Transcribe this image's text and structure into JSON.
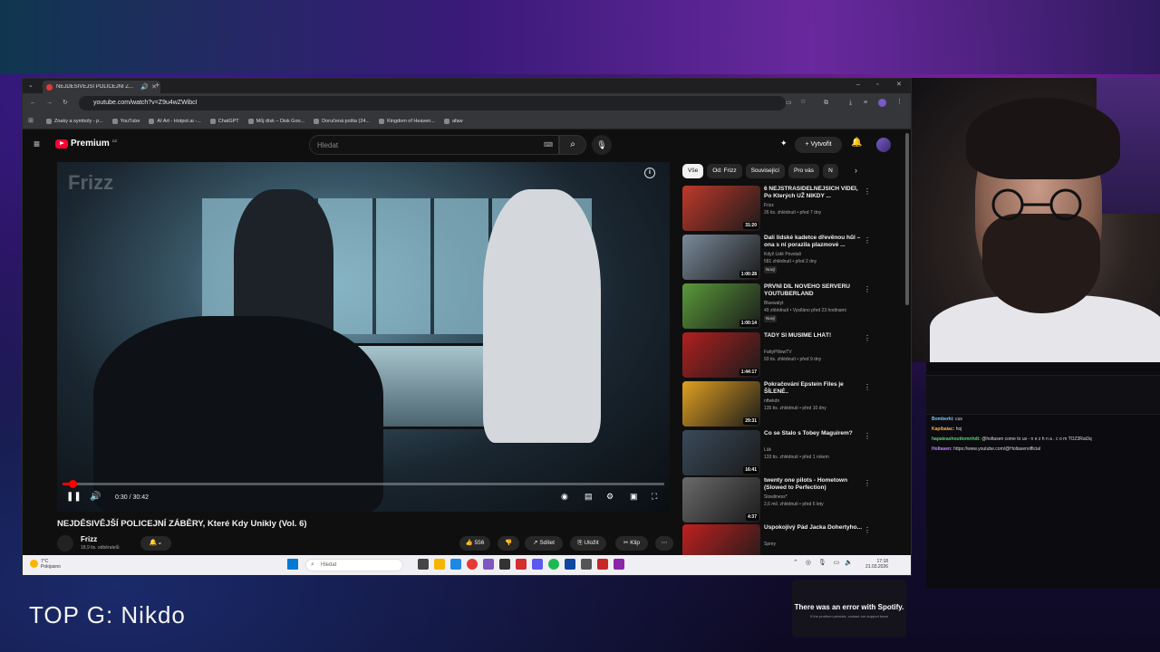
{
  "overlay": {
    "top_g_label": "TOP G: Nikdo",
    "spotify_error_title": "There was an error with Spotify.",
    "spotify_error_sub": "If the problem persists, contact our support team",
    "chat": [
      {
        "name": "Bomberki:",
        "text": "cus",
        "color": "#7ec8ff"
      },
      {
        "name": "Kapibaiac:",
        "text": "hoj",
        "color": "#ffb04a"
      },
      {
        "name": "hapaieashouttomnhdt:",
        "text": "@holtasen come to us - n e z h n a . c o m TOZ3Rat3q",
        "color": "#5ad07a"
      },
      {
        "name": "Holtasen:",
        "text": "https://www.youtube.com/@Holtasenofficial",
        "color": "#c08aff"
      }
    ]
  },
  "browser": {
    "tab_title": "NEJDĚSIVĚJŠÍ POLICEJNÍ Z...",
    "url": "youtube.com/watch?v=Z9u4wZWibcI",
    "bookmarks": [
      "Znaky a symboly - p...",
      "YouTube",
      "AI Art - Hotpot.ai -...",
      "ChatGPT",
      "Můj disk – Disk Goo...",
      "Doručená pošta (24...",
      "Kingdom of Heaven...",
      "afaw"
    ]
  },
  "youtube": {
    "logo_text": "Premium",
    "logo_region": "CZ",
    "search_placeholder": "Hledat",
    "create_label": "Vytvořit",
    "watermark": "Frizz",
    "time": "0:30 / 30:42",
    "progress_fraction": 0.016,
    "video_title": "NEJDĚSIVĚJŠÍ POLICEJNÍ ZÁBĚRY, Které Kdy Unikly (Vol. 6)",
    "channel": "Frizz",
    "subscribers": "18,9 tis. odběratelů",
    "likes": "556",
    "share_label": "Sdílet",
    "save_label": "Uložit",
    "clip_label": "Klip",
    "chips": [
      "Vše",
      "Od: Frizz",
      "Související",
      "Pro vás",
      "N"
    ],
    "recommendations": [
      {
        "title": "6 NEJSTRAŠIDELNĚJŠÍCH VIDEÍ, Po Kterých UŽ NIKDY ...",
        "channel": "Frizz",
        "meta": "26 tis. zhlédnutí • před 7 dny",
        "duration": "31:20",
        "badge": "",
        "thumb": "#c0392b"
      },
      {
        "title": "Dali lidské kadetce dřevěnou hůl – ona s ní porazila plazmové ...",
        "channel": "Když Lidé Povstali",
        "meta": "581 zhlédnutí • před 2 dny",
        "duration": "1:00:28",
        "badge": "Nový",
        "thumb": "#7a8a9a"
      },
      {
        "title": "PRVNÍ DÍL NOVÉHO SERVERU YOUTUBERLAND",
        "channel": "Bluewalyt",
        "meta": "49 zhlédnutí • Vysíláno před 23 hodinami",
        "duration": "1:00:14",
        "badge": "Nový",
        "thumb": "#5a9a3a"
      },
      {
        "title": "TADY SI MUSÍME LHÁT!",
        "channel": "FattyPillowTV",
        "meta": "93 tis. zhlédnutí • před 9 dny",
        "duration": "1:44:17",
        "badge": "",
        "thumb": "#b02020"
      },
      {
        "title": "Pokračování Epstein Files je ŠÍLENÉ..",
        "channel": "nftwkdn",
        "meta": "135 tis. zhlédnutí • před 10 dny",
        "duration": "29:31",
        "badge": "",
        "thumb": "#e0a020"
      },
      {
        "title": "Co se Stalo s Tobey Maguirem?",
        "channel": "Lük",
        "meta": "133 tis. zhlédnutí • před 1 rokem",
        "duration": "16:41",
        "badge": "",
        "thumb": "#3a4a5a"
      },
      {
        "title": "twenty one pilots - Hometown (Slowed to Perfection)",
        "channel": "Slowliness*",
        "meta": "2,6 mil. zhlédnutí • před 6 lety",
        "duration": "4:37",
        "badge": "",
        "thumb": "#6a6a6a"
      },
      {
        "title": "Uspokojivý Pád Jacka Dohertyho...",
        "channel": "Sprey",
        "meta": "",
        "duration": "",
        "badge": "",
        "thumb": "#c02020"
      }
    ]
  },
  "taskbar": {
    "weather_temp": "7°C",
    "weather_desc": "Polojasno",
    "search_placeholder": "Hledat",
    "time": "17:18",
    "date": "21.03.2026"
  }
}
